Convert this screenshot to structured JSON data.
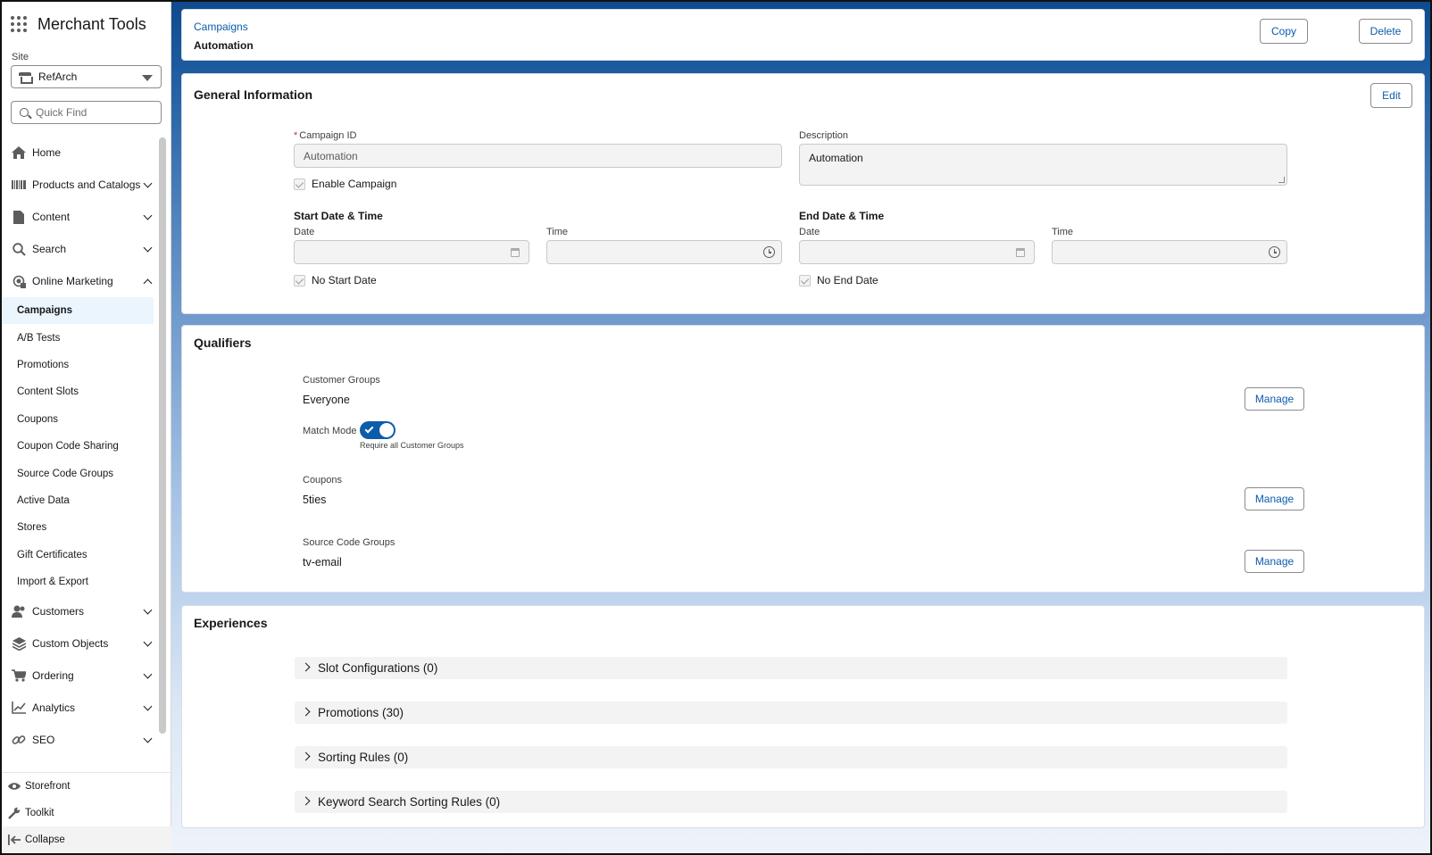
{
  "app": {
    "title": "Merchant Tools"
  },
  "site": {
    "label": "Site",
    "value": "RefArch"
  },
  "quick_find": {
    "placeholder": "Quick Find"
  },
  "nav": {
    "home": "Home",
    "products": "Products and Catalogs",
    "content": "Content",
    "search": "Search",
    "online_marketing": "Online Marketing",
    "sub_items": [
      "Campaigns",
      "A/B Tests",
      "Promotions",
      "Content Slots",
      "Coupons",
      "Coupon Code Sharing",
      "Source Code Groups",
      "Active Data",
      "Stores",
      "Gift Certificates",
      "Import & Export"
    ],
    "customers": "Customers",
    "custom_objects": "Custom Objects",
    "ordering": "Ordering",
    "analytics": "Analytics",
    "seo": "SEO",
    "storefront": "Storefront",
    "toolkit": "Toolkit",
    "collapse": "Collapse"
  },
  "header": {
    "breadcrumb": "Campaigns",
    "record_name": "Automation",
    "copy_label": "Copy",
    "delete_label": "Delete"
  },
  "general": {
    "title": "General Information",
    "edit_label": "Edit",
    "campaign_id_label": "Campaign ID",
    "required_mark": "*",
    "campaign_id_value": "Automation",
    "description_label": "Description",
    "description_value": "Automation",
    "enable_label": "Enable Campaign",
    "start_heading": "Start Date & Time",
    "end_heading": "End Date & Time",
    "date_label": "Date",
    "time_label": "Time",
    "no_start_label": "No Start Date",
    "no_end_label": "No End Date"
  },
  "qualifiers": {
    "title": "Qualifiers",
    "customer_groups_label": "Customer Groups",
    "customer_groups_value": "Everyone",
    "match_mode_label": "Match Mode",
    "match_mode_caption": "Require all Customer Groups",
    "coupons_label": "Coupons",
    "coupons_value": "5ties",
    "source_code_groups_label": "Source Code Groups",
    "source_code_groups_value": "tv-email",
    "manage_label": "Manage"
  },
  "experiences": {
    "title": "Experiences",
    "sections": [
      "Slot Configurations (0)",
      "Promotions (30)",
      "Sorting Rules (0)",
      "Keyword Search Sorting Rules (0)"
    ]
  }
}
